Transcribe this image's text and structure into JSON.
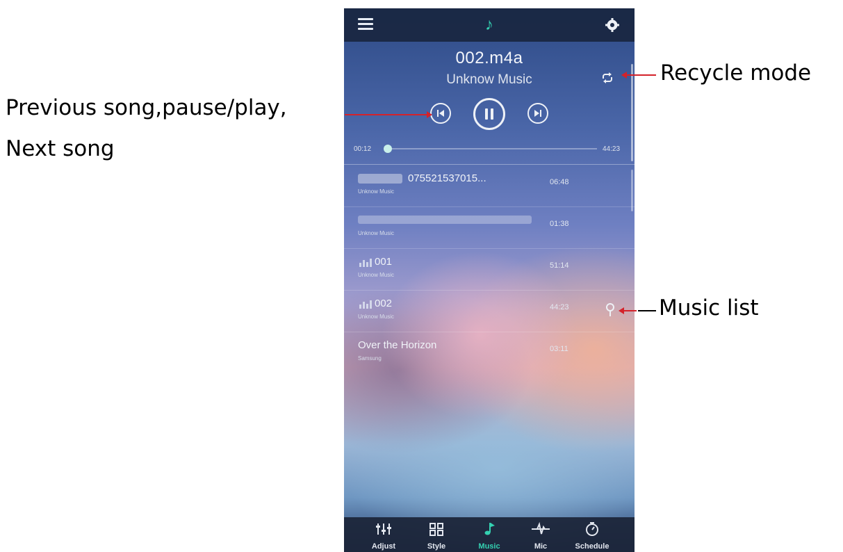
{
  "app": {
    "now_playing": {
      "title": "002.m4a",
      "artist": "Unknow Music",
      "current_time": "00:12",
      "total_time": "44:23",
      "progress": 0.01
    },
    "songs": [
      {
        "title": "075521537015...",
        "artist": "Unknow Music",
        "duration": "06:48"
      },
      {
        "title": "",
        "artist": "Unknow Music",
        "duration": "01:38"
      },
      {
        "title": "001",
        "artist": "Unknow Music",
        "duration": "51:14"
      },
      {
        "title": "002",
        "artist": "Unknow Music",
        "duration": "44:23"
      },
      {
        "title": "Over the Horizon",
        "artist": "Samsung",
        "duration": "03:11"
      }
    ],
    "tabs": [
      {
        "label": "Adjust",
        "icon": "sliders-icon"
      },
      {
        "label": "Style",
        "icon": "grid-icon"
      },
      {
        "label": "Music",
        "icon": "music-note-icon"
      },
      {
        "label": "Mic",
        "icon": "mic-icon"
      },
      {
        "label": "Schedule",
        "icon": "timer-icon"
      }
    ],
    "active_tab": "Music",
    "accent_color": "#34d1b1",
    "icons": [
      "menu-icon",
      "music-note-icon",
      "gear-icon",
      "recycle-icon",
      "previous-icon",
      "pause-icon",
      "next-icon",
      "pin-icon"
    ]
  },
  "annotations": {
    "controls": [
      "Previous song,pause/play,",
      "Next song"
    ],
    "recycle": "Recycle mode",
    "music_list": "Music list",
    "line_color": "#d4222a"
  }
}
